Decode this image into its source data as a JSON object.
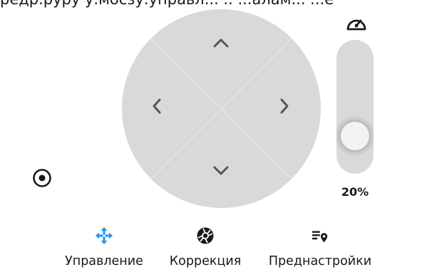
{
  "top_caption": "редр.руру у.мосзу.управл... .. ...алам... ...е",
  "speed": {
    "icon": "speedometer-icon",
    "value_text": "20%",
    "level_fraction": 0.2
  },
  "controls": {
    "up_icon": "chevron-up-icon",
    "down_icon": "chevron-down-icon",
    "left_icon": "chevron-left-icon",
    "right_icon": "chevron-right-icon",
    "target_icon": "target-icon"
  },
  "tabs": [
    {
      "label": "Управление",
      "icon": "move-arrows-icon",
      "active": true,
      "color": "#2196f3"
    },
    {
      "label": "Коррекция",
      "icon": "aperture-icon",
      "active": false,
      "color": "#1a1a1a"
    },
    {
      "label": "Преднастройки",
      "icon": "preset-list-icon",
      "active": false,
      "color": "#1a1a1a"
    }
  ]
}
